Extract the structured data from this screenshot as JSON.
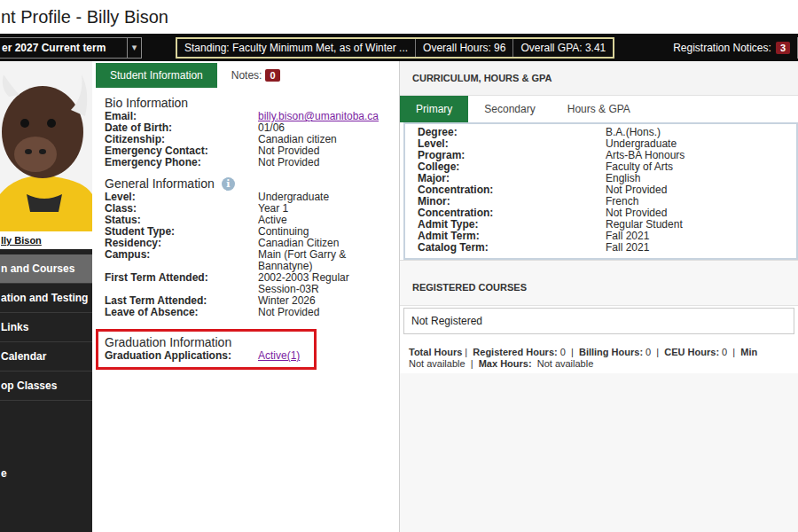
{
  "page": {
    "title": "nt Profile - Billy Bison"
  },
  "term_bar": {
    "term": "er 2027 Current term",
    "arrow": "▾",
    "stats": [
      "Standing: Faculty Minimum Met, as of Winter ...",
      "Overall Hours: 96",
      "Overall GPA: 3.41"
    ],
    "notices": {
      "label": "Registration Notices:",
      "count": "3"
    }
  },
  "profile": {
    "name": "lly Bison"
  },
  "sidebar": {
    "items": [
      {
        "label": "n and Courses",
        "selected": true
      },
      {
        "label": "ation and Testing",
        "selected": false
      },
      {
        "label": "Links",
        "selected": false
      },
      {
        "label": "Calendar",
        "selected": false
      },
      {
        "label": "op Classes",
        "selected": false
      },
      {
        "label": "e",
        "selected": false
      }
    ]
  },
  "info_tabs": [
    {
      "label": "Student Information",
      "selected": true
    },
    {
      "label": "Notes:",
      "count": "0",
      "selected": false
    }
  ],
  "bio": {
    "title": "Bio Information",
    "rows": [
      {
        "label": "Email:",
        "value": "billy.bison@umanitoba.ca",
        "kind": "link"
      },
      {
        "label": "Date of Birth:",
        "value": "01/06",
        "kind": "text"
      },
      {
        "label": "Citizenship:",
        "value": "Canadian citizen",
        "kind": "text"
      },
      {
        "label": "Emergency Contact:",
        "value": "Not Provided",
        "kind": "text"
      },
      {
        "label": "Emergency Phone:",
        "value": "Not Provided",
        "kind": "text"
      }
    ]
  },
  "general": {
    "title": "General Information",
    "icon": "i",
    "rows": [
      {
        "label": "Level:",
        "value": "Undergraduate",
        "kind": "text"
      },
      {
        "label": "Class:",
        "value": "Year 1",
        "kind": "text"
      },
      {
        "label": "Status:",
        "value": "Active",
        "kind": "text"
      },
      {
        "label": "Student Type:",
        "value": "Continuing",
        "kind": "text"
      },
      {
        "label": "Residency:",
        "value": "Canadian Citizen",
        "kind": "text"
      },
      {
        "label": "Campus:",
        "value": "Main (Fort Garry & Bannatyne)",
        "kind": "text"
      },
      {
        "label": "First Term Attended:",
        "value": "2002-2003 Regular Session-03R",
        "kind": "text"
      },
      {
        "label": "Last Term Attended:",
        "value": "Winter 2026",
        "kind": "text"
      },
      {
        "label": "Leave of Absence:",
        "value": "Not Provided",
        "kind": "text"
      }
    ]
  },
  "graduation": {
    "title": "Graduation Information",
    "rows": [
      {
        "label": "Graduation Applications:",
        "value": "Active(1)",
        "kind": "link"
      }
    ]
  },
  "curriculum": {
    "title": "CURRICULUM, HOURS & GPA",
    "tabs": [
      {
        "label": "Primary",
        "selected": true
      },
      {
        "label": "Secondary",
        "selected": false
      },
      {
        "label": "Hours & GPA",
        "selected": false
      }
    ],
    "rows": [
      {
        "label": "Degree:",
        "value": "B.A.(Hons.)"
      },
      {
        "label": "Level:",
        "value": "Undergraduate"
      },
      {
        "label": "Program:",
        "value": "Arts-BA Honours"
      },
      {
        "label": "College:",
        "value": "Faculty of Arts"
      },
      {
        "label": "Major:",
        "value": "English"
      },
      {
        "label": "Concentration:",
        "value": "Not Provided"
      },
      {
        "label": "Minor:",
        "value": "French"
      },
      {
        "label": "Concentration:",
        "value": "Not Provided"
      },
      {
        "label": "Admit Type:",
        "value": "Regular Student"
      },
      {
        "label": "Admit Term:",
        "value": "Fall 2021"
      },
      {
        "label": "Catalog Term:",
        "value": "Fall 2021"
      }
    ]
  },
  "registered": {
    "title": "REGISTERED COURSES",
    "empty": "Not Registered",
    "totals": [
      [
        {
          "text": "Total Hours",
          "bold": true
        },
        {
          "text": " |  ",
          "bold": false
        },
        {
          "text": "Registered Hours:",
          "bold": true
        },
        {
          "text": " 0  |  ",
          "bold": false
        },
        {
          "text": "Billing Hours:",
          "bold": true
        },
        {
          "text": " 0  |  ",
          "bold": false
        },
        {
          "text": "CEU Hours:",
          "bold": true
        },
        {
          "text": " 0  |  ",
          "bold": false
        },
        {
          "text": "Min",
          "bold": true
        }
      ],
      [
        {
          "text": "Not available",
          "bold": false
        },
        {
          "text": "  |  ",
          "bold": false
        },
        {
          "text": "Max Hours:",
          "bold": true
        },
        {
          "text": "  Not available",
          "bold": false
        }
      ]
    ]
  }
}
